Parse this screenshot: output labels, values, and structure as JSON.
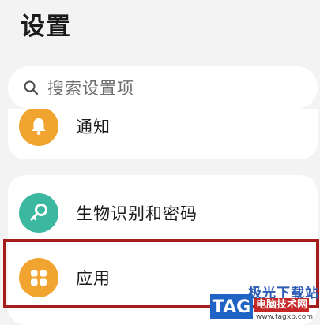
{
  "header": {
    "title": "设置"
  },
  "search": {
    "placeholder": "搜索设置项"
  },
  "settings_list": {
    "items": [
      {
        "label": "通知",
        "icon": "bell-icon",
        "icon_color": "#f2a431"
      },
      {
        "label": "生物识别和密码",
        "icon": "key-icon",
        "icon_color": "#3cb8a0"
      },
      {
        "label": "应用",
        "icon": "apps-grid-icon",
        "icon_color": "#f2a431"
      }
    ]
  },
  "annotation": {
    "highlight_color": "#a51c1c",
    "highlighted_item": "应用"
  },
  "watermark": {
    "site_name": "极光下载站",
    "tag": "TAG",
    "sub_text": "电脑技术网",
    "url": "www.tagxp.com"
  }
}
